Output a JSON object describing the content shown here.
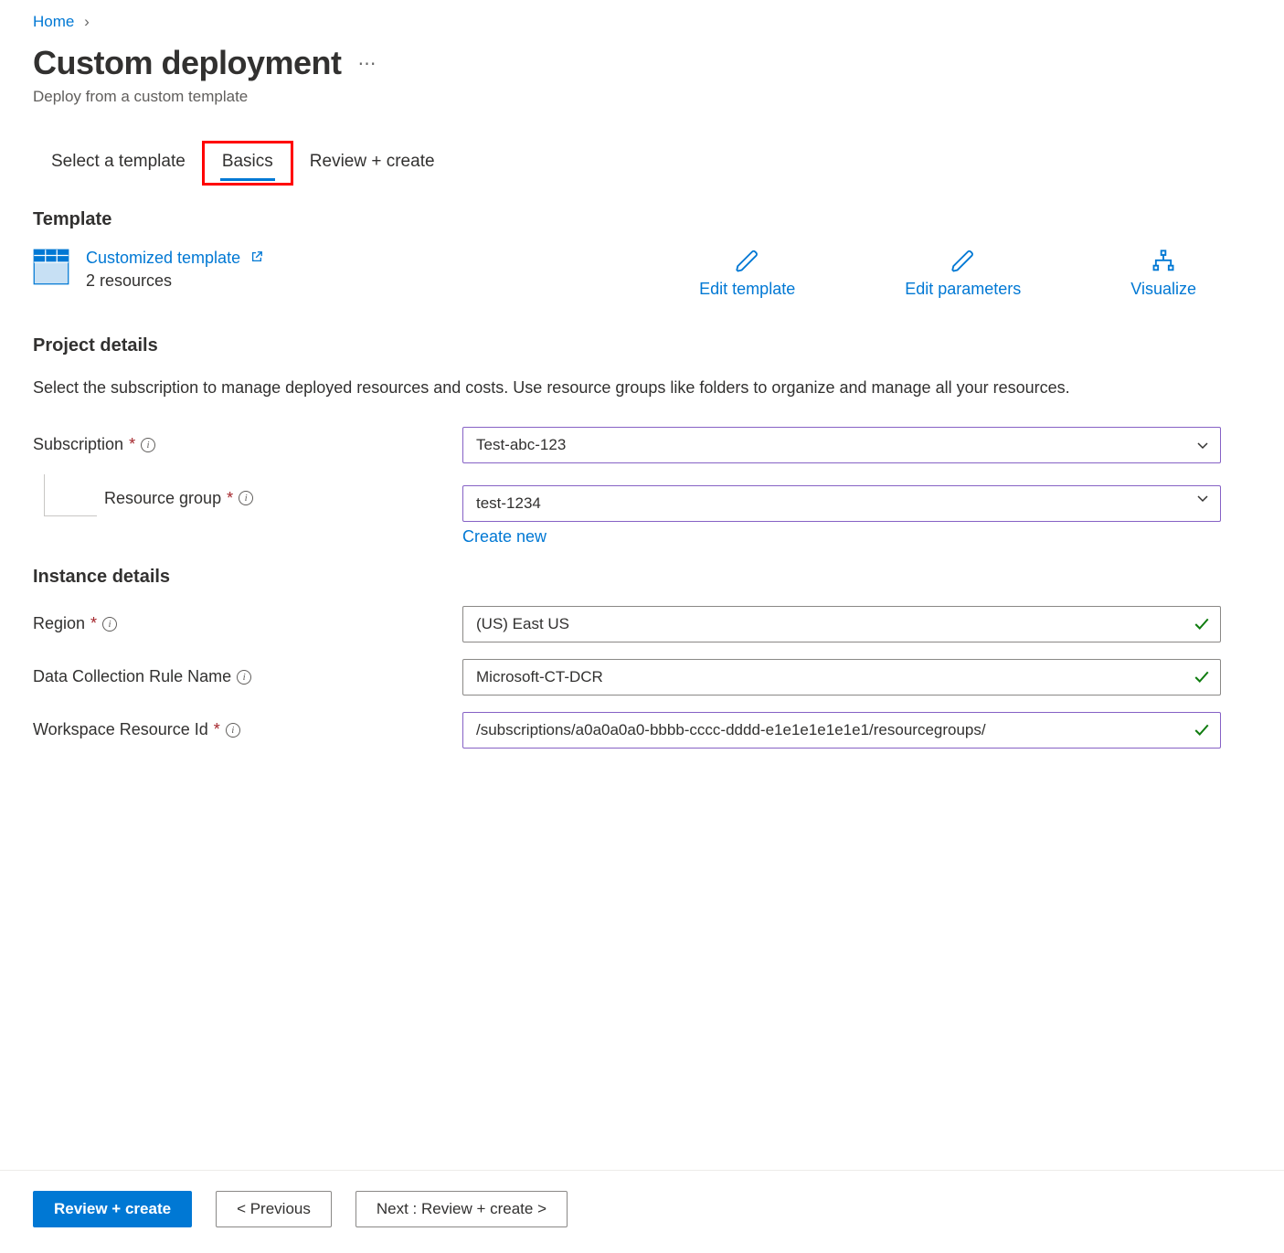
{
  "breadcrumb": {
    "home": "Home"
  },
  "header": {
    "title": "Custom deployment",
    "subtitle": "Deploy from a custom template"
  },
  "tabs": {
    "select_template": "Select a template",
    "basics": "Basics",
    "review": "Review + create"
  },
  "template": {
    "section_title": "Template",
    "link_label": "Customized template",
    "resource_count": "2 resources"
  },
  "actions": {
    "edit_template": "Edit template",
    "edit_parameters": "Edit parameters",
    "visualize": "Visualize"
  },
  "project_details": {
    "section_title": "Project details",
    "help_text": "Select the subscription to manage deployed resources and costs. Use resource groups like folders to organize and manage all your resources.",
    "subscription_label": "Subscription",
    "subscription_value": "Test-abc-123",
    "resource_group_label": "Resource group",
    "resource_group_value": "test-1234",
    "create_new": "Create new"
  },
  "instance_details": {
    "section_title": "Instance details",
    "region_label": "Region",
    "region_value": "(US) East US",
    "dcr_label": "Data Collection Rule Name",
    "dcr_value": "Microsoft-CT-DCR",
    "workspace_label": "Workspace Resource Id",
    "workspace_value": "/subscriptions/a0a0a0a0-bbbb-cccc-dddd-e1e1e1e1e1e1/resourcegroups/"
  },
  "footer": {
    "review": "Review + create",
    "previous": "< Previous",
    "next": "Next : Review + create >"
  }
}
